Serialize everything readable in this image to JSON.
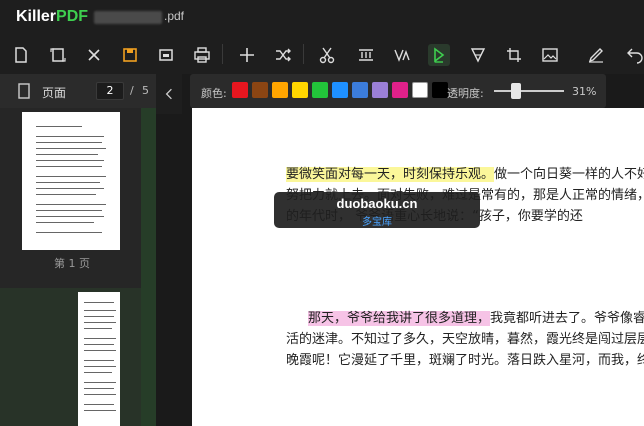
{
  "app": {
    "brand_main": "Killer",
    "brand_accent": "PDF",
    "file_ext": ".pdf"
  },
  "toolbar": {
    "icons": [
      "new-file-icon",
      "page-icon",
      "close-icon",
      "save-icon",
      "image-icon",
      "print-icon",
      "add-icon",
      "shuffle-icon",
      "cut-icon",
      "crop-text-icon",
      "resize-icon",
      "highlighter-icon",
      "cone-icon",
      "crop-icon",
      "picture-icon",
      "sign-icon",
      "undo-icon"
    ],
    "active_icon": "highlighter-icon"
  },
  "sidebar": {
    "label": "页面",
    "current_page": "2",
    "separator": "/",
    "total_pages": "5",
    "thumb_caption": "第 1 页"
  },
  "color_popup": {
    "color_label": "颜色:",
    "colors": [
      "#e8161f",
      "#8b4513",
      "#ffa500",
      "#ffd700",
      "#22c33a",
      "#1e90ff",
      "#3c7ddb",
      "#9b7fd6",
      "#e0218a",
      "#ffffff",
      "#000000"
    ],
    "opacity_label": "透明度:",
    "opacity_value": "31%",
    "opacity_fraction": 0.31
  },
  "document": {
    "lines": [
      {
        "highlight": "要微笑面对每一天，时刻保持乐观。",
        "rest": "做一个向日葵一样的人不好吗？你"
      },
      {
        "highlight": "",
        "rest": "努把力就上去。面对失败，难过是常有的，那是人正常的情绪，但不能"
      },
      {
        "highlight": "",
        "rest": "的年代时，                                    爷爷语重心长地说：“孩子，你要学的还"
      },
      {
        "highlight": "那天，爷爷给我讲了很多道理，",
        "rest": "我竟都听进去了。爷爷像睿智的长"
      },
      {
        "highlight": "",
        "rest": "活的迷津。不知过了多久，天空放晴，暮然，霞光终是闯过层层乌云，"
      },
      {
        "highlight": "",
        "rest": "晚霞呢！它漫延了千里，斑斓了时光。落日跌入星河，而我，终是释然"
      }
    ]
  },
  "watermark": {
    "main": "duobaoku.cn",
    "sub": "多宝库"
  }
}
